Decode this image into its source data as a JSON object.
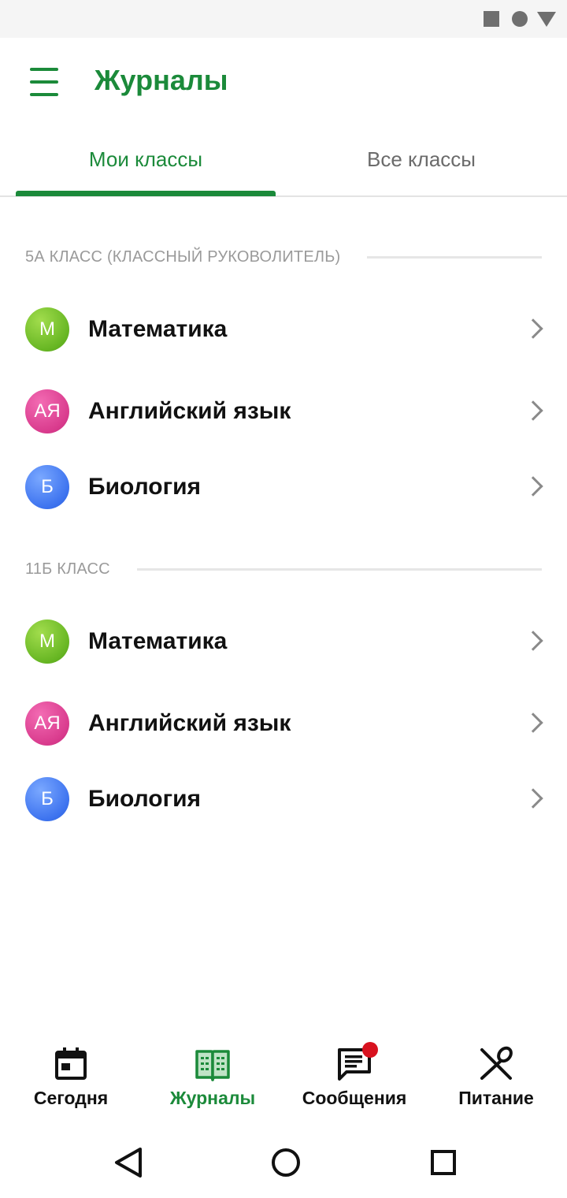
{
  "app": {
    "title": "Журналы"
  },
  "tabs": [
    {
      "label": "Мои классы",
      "active": true
    },
    {
      "label": "Все классы",
      "active": false
    }
  ],
  "sections": [
    {
      "title": "5А КЛАСС (КЛАССНЫЙ РУКОВОЛИТЕЛЬ)",
      "items": [
        {
          "initials": "М",
          "name": "Математика",
          "color": "#67b623"
        },
        {
          "initials": "АЯ",
          "name": "Английский язык",
          "color": "#d93b8d"
        },
        {
          "initials": "Б",
          "name": "Биология",
          "color": "#3d73ef"
        }
      ]
    },
    {
      "title": "11Б КЛАСС",
      "items": [
        {
          "initials": "М",
          "name": "Математика",
          "color": "#67b623"
        },
        {
          "initials": "АЯ",
          "name": "Английский язык",
          "color": "#d93b8d"
        },
        {
          "initials": "Б",
          "name": "Биология",
          "color": "#3d73ef"
        }
      ]
    }
  ],
  "bottom_nav": [
    {
      "label": "Сегодня",
      "icon": "calendar-icon",
      "active": false
    },
    {
      "label": "Журналы",
      "icon": "journal-icon",
      "active": true
    },
    {
      "label": "Сообщения",
      "icon": "message-icon",
      "active": false,
      "badge": true
    },
    {
      "label": "Питание",
      "icon": "food-icon",
      "active": false
    }
  ],
  "colors": {
    "accent": "#1b8a3a",
    "badge": "#d8121f",
    "inactive_tab": "#6b6b6b",
    "section_title": "#9a9a9a"
  },
  "icons": {
    "status_bar": [
      "square-icon",
      "circle-icon",
      "triangle-icon"
    ],
    "system_nav": [
      "back-icon",
      "home-icon",
      "recents-icon"
    ],
    "menu": "hamburger-menu-icon",
    "row_action": "chevron-right-icon"
  }
}
